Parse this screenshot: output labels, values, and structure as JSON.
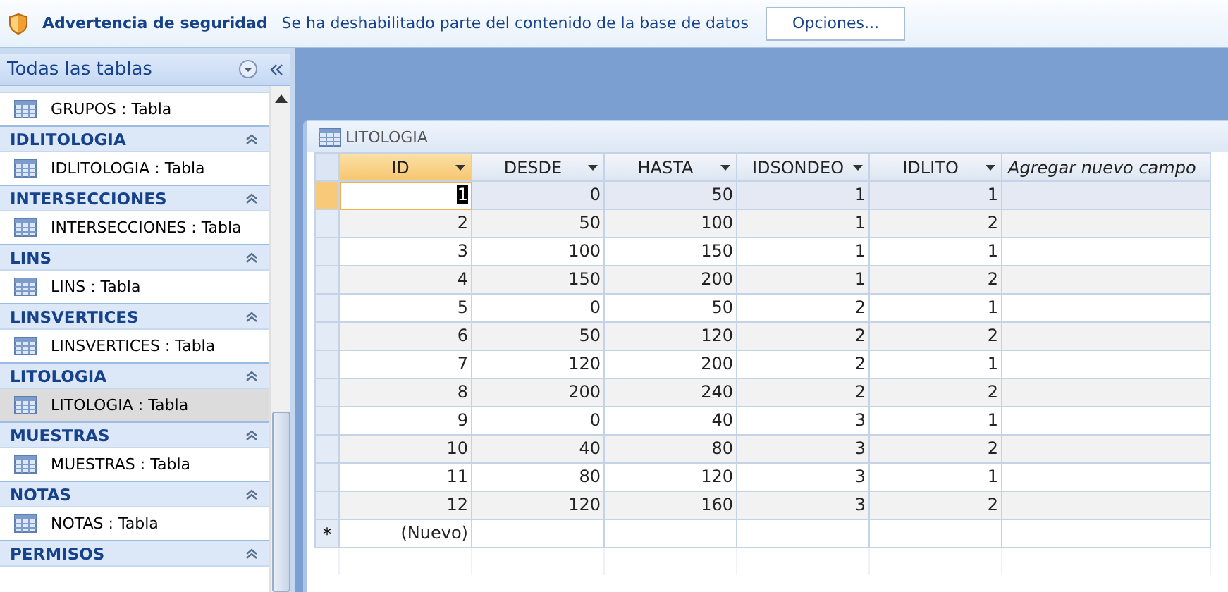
{
  "security_bar": {
    "title": "Advertencia de seguridad",
    "message": "Se ha deshabilitado parte del contenido de la base de datos",
    "button": "Opciones..."
  },
  "nav_pane": {
    "title": "Todas las tablas",
    "groups": [
      {
        "items": [
          {
            "label": "GRUPOS : Tabla",
            "selected": false
          }
        ]
      },
      {
        "name": "IDLITOLOGIA",
        "items": [
          {
            "label": "IDLITOLOGIA : Tabla",
            "selected": false
          }
        ]
      },
      {
        "name": "INTERSECCIONES",
        "items": [
          {
            "label": "INTERSECCIONES : Tabla",
            "selected": false
          }
        ]
      },
      {
        "name": "LINS",
        "items": [
          {
            "label": "LINS : Tabla",
            "selected": false
          }
        ]
      },
      {
        "name": "LINSVERTICES",
        "items": [
          {
            "label": "LINSVERTICES : Tabla",
            "selected": false
          }
        ]
      },
      {
        "name": "LITOLOGIA",
        "items": [
          {
            "label": "LITOLOGIA : Tabla",
            "selected": true
          }
        ]
      },
      {
        "name": "MUESTRAS",
        "items": [
          {
            "label": "MUESTRAS : Tabla",
            "selected": false
          }
        ]
      },
      {
        "name": "NOTAS",
        "items": [
          {
            "label": "NOTAS : Tabla",
            "selected": false
          }
        ]
      },
      {
        "name": "PERMISOS"
      }
    ]
  },
  "table_window": {
    "title": "LITOLOGIA",
    "columns": [
      {
        "label": "ID",
        "kind": "field",
        "selected": true
      },
      {
        "label": "DESDE",
        "kind": "field",
        "selected": false
      },
      {
        "label": "HASTA",
        "kind": "field",
        "selected": false
      },
      {
        "label": "IDSONDEO",
        "kind": "field",
        "selected": false
      },
      {
        "label": "IDLITO",
        "kind": "field",
        "selected": false
      },
      {
        "label": "Agregar nuevo campo",
        "kind": "add",
        "selected": false
      }
    ],
    "rows": [
      {
        "cells": [
          "1",
          "0",
          "50",
          "1",
          "1"
        ],
        "selected": true
      },
      {
        "cells": [
          "2",
          "50",
          "100",
          "1",
          "2"
        ],
        "selected": false
      },
      {
        "cells": [
          "3",
          "100",
          "150",
          "1",
          "1"
        ],
        "selected": false
      },
      {
        "cells": [
          "4",
          "150",
          "200",
          "1",
          "2"
        ],
        "selected": false
      },
      {
        "cells": [
          "5",
          "0",
          "50",
          "2",
          "1"
        ],
        "selected": false
      },
      {
        "cells": [
          "6",
          "50",
          "120",
          "2",
          "2"
        ],
        "selected": false
      },
      {
        "cells": [
          "7",
          "120",
          "200",
          "2",
          "1"
        ],
        "selected": false
      },
      {
        "cells": [
          "8",
          "200",
          "240",
          "2",
          "2"
        ],
        "selected": false
      },
      {
        "cells": [
          "9",
          "0",
          "40",
          "3",
          "1"
        ],
        "selected": false
      },
      {
        "cells": [
          "10",
          "40",
          "80",
          "3",
          "2"
        ],
        "selected": false
      },
      {
        "cells": [
          "11",
          "80",
          "120",
          "3",
          "1"
        ],
        "selected": false
      },
      {
        "cells": [
          "12",
          "120",
          "160",
          "3",
          "2"
        ],
        "selected": false
      }
    ],
    "new_row": {
      "marker": "*",
      "label": "(Nuevo)"
    }
  }
}
